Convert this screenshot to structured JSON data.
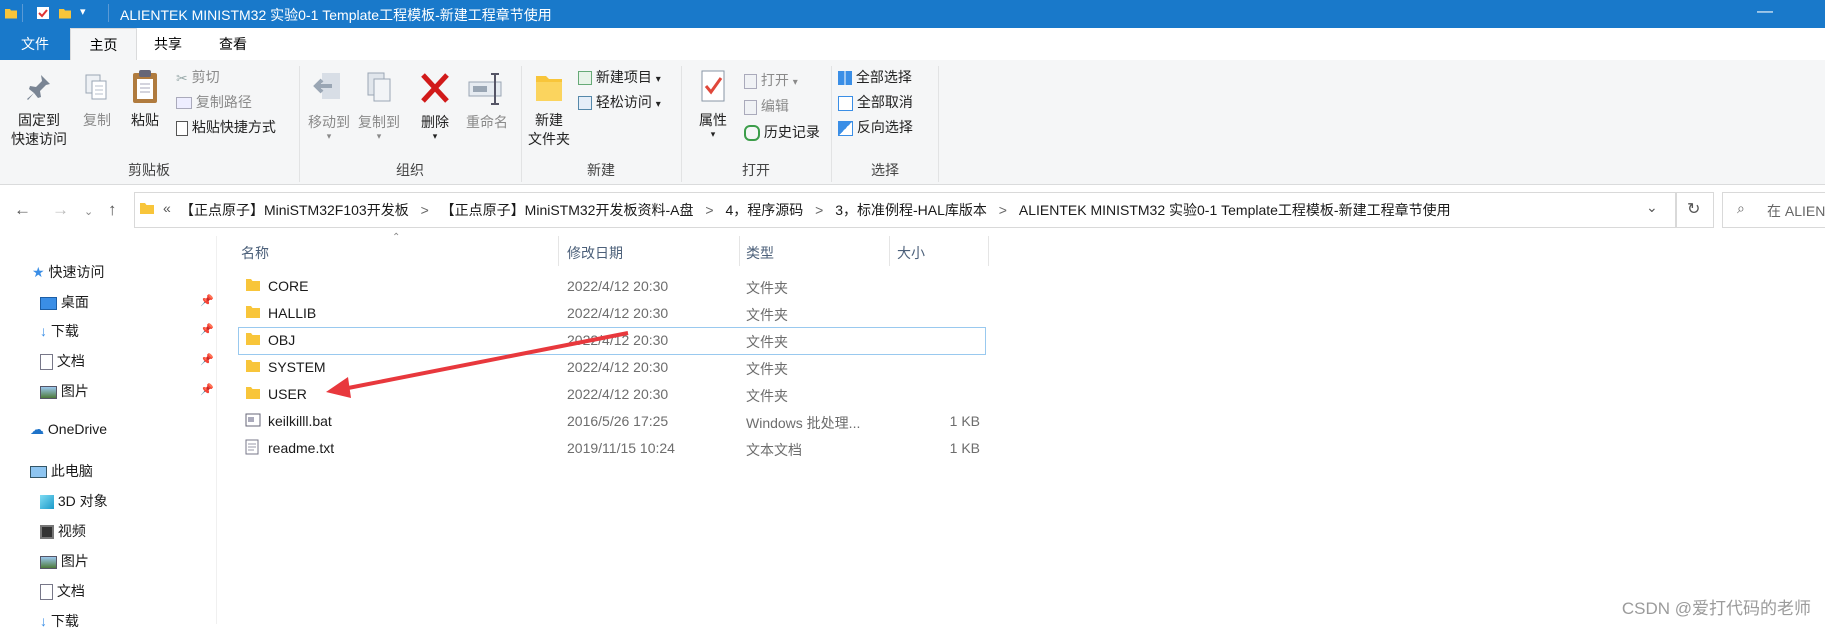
{
  "window": {
    "title": "ALIENTEK MINISTM32 实验0-1 Template工程模板-新建工程章节使用",
    "minimize_glyph": "—"
  },
  "quick_access": {
    "icons": [
      "folder-icon",
      "properties-check-icon",
      "new-folder-icon",
      "dropdown-arrow-icon"
    ]
  },
  "ribbon_tabs": [
    "文件",
    "主页",
    "共享",
    "查看"
  ],
  "ribbon": {
    "clipboard": {
      "label": "剪贴板",
      "pin": "固定到\n快速访问",
      "copy": "复制",
      "paste": "粘贴",
      "cut": "剪切",
      "copy_path": "复制路径",
      "paste_shortcut": "粘贴快捷方式"
    },
    "organize": {
      "label": "组织",
      "move_to": "移动到",
      "copy_to": "复制到",
      "delete": "删除",
      "rename": "重命名"
    },
    "new": {
      "label": "新建",
      "new_folder": "新建\n文件夹",
      "new_item": "新建项目",
      "easy_access": "轻松访问"
    },
    "open": {
      "label": "打开",
      "properties": "属性",
      "open": "打开",
      "edit": "编辑",
      "history": "历史记录"
    },
    "select": {
      "label": "选择",
      "select_all": "全部选择",
      "select_none": "全部取消",
      "invert": "反向选择"
    }
  },
  "address_bar": {
    "overflow": "«",
    "crumbs": [
      "【正点原子】MiniSTM32F103开发板",
      "【正点原子】MiniSTM32开发板资料-A盘",
      "4，程序源码",
      "3，标准例程-HAL库版本",
      "ALIENTEK MINISTM32 实验0-1 Template工程模板-新建工程章节使用"
    ],
    "separator": ">",
    "search_placeholder": "在 ALIEN"
  },
  "nav_pane": {
    "quick_access": "快速访问",
    "quick_items": [
      "桌面",
      "下载",
      "文档",
      "图片"
    ],
    "onedrive": "OneDrive",
    "this_pc": "此电脑",
    "pc_items": [
      "3D 对象",
      "视频",
      "图片",
      "文档",
      "下载"
    ]
  },
  "columns": {
    "name": "名称",
    "modified": "修改日期",
    "type": "类型",
    "size": "大小"
  },
  "files": [
    {
      "name": "CORE",
      "modified": "2022/4/12 20:30",
      "type": "文件夹",
      "size": "",
      "kind": "folder"
    },
    {
      "name": "HALLIB",
      "modified": "2022/4/12 20:30",
      "type": "文件夹",
      "size": "",
      "kind": "folder"
    },
    {
      "name": "OBJ",
      "modified": "2022/4/12 20:30",
      "type": "文件夹",
      "size": "",
      "kind": "folder"
    },
    {
      "name": "SYSTEM",
      "modified": "2022/4/12 20:30",
      "type": "文件夹",
      "size": "",
      "kind": "folder"
    },
    {
      "name": "USER",
      "modified": "2022/4/12 20:30",
      "type": "文件夹",
      "size": "",
      "kind": "folder"
    },
    {
      "name": "keilkilll.bat",
      "modified": "2016/5/26 17:25",
      "type": "Windows 批处理...",
      "size": "1 KB",
      "kind": "bat"
    },
    {
      "name": "readme.txt",
      "modified": "2019/11/15 10:24",
      "type": "文本文档",
      "size": "1 KB",
      "kind": "txt"
    }
  ],
  "selected_row": "OBJ",
  "annotation": {
    "color": "#e8383d"
  },
  "watermark": "CSDN @爱打代码的老师",
  "colors": {
    "titlebar": "#1979ca",
    "ribbon": "#f5f6f7",
    "folder": "#f8c53a"
  }
}
